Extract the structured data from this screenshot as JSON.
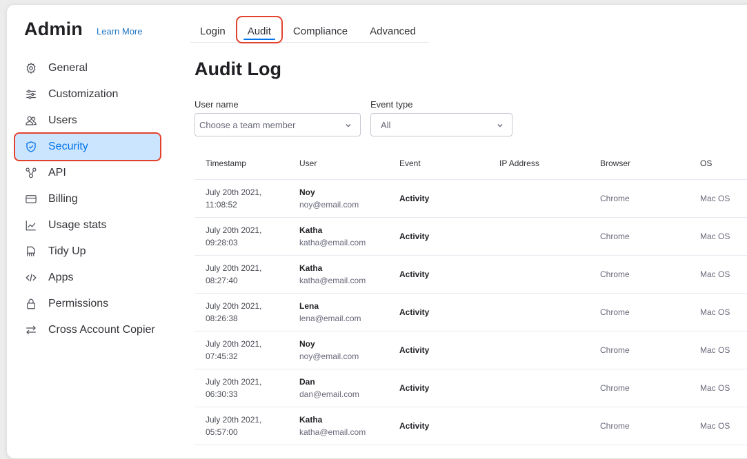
{
  "app": {
    "title": "Admin",
    "learn_more": "Learn More"
  },
  "sidebar": {
    "items": [
      {
        "label": "General",
        "icon": "gear-icon"
      },
      {
        "label": "Customization",
        "icon": "sliders-icon"
      },
      {
        "label": "Users",
        "icon": "users-icon"
      },
      {
        "label": "Security",
        "icon": "shield-icon",
        "active": true
      },
      {
        "label": "API",
        "icon": "api-icon"
      },
      {
        "label": "Billing",
        "icon": "credit-card-icon"
      },
      {
        "label": "Usage stats",
        "icon": "chart-icon"
      },
      {
        "label": "Tidy Up",
        "icon": "broom-icon"
      },
      {
        "label": "Apps",
        "icon": "code-icon"
      },
      {
        "label": "Permissions",
        "icon": "lock-icon"
      },
      {
        "label": "Cross Account Copier",
        "icon": "transfer-icon"
      }
    ]
  },
  "tabs": [
    {
      "label": "Login"
    },
    {
      "label": "Audit",
      "active": true
    },
    {
      "label": "Compliance"
    },
    {
      "label": "Advanced"
    }
  ],
  "page": {
    "title": "Audit Log"
  },
  "filters": {
    "user": {
      "label": "User name",
      "placeholder": "Choose a team member"
    },
    "event": {
      "label": "Event type",
      "value": "All"
    }
  },
  "table": {
    "headers": [
      "Timestamp",
      "User",
      "Event",
      "IP Address",
      "Browser",
      "OS"
    ],
    "rows": [
      {
        "date": "July 20th 2021,",
        "time": "11:08:52",
        "name": "Noy",
        "email": "noy@email.com",
        "event": "Activity",
        "ip": "",
        "browser": "Chrome",
        "os": "Mac OS"
      },
      {
        "date": "July 20th 2021,",
        "time": "09:28:03",
        "name": "Katha",
        "email": "katha@email.com",
        "event": "Activity",
        "ip": "",
        "browser": "Chrome",
        "os": "Mac OS"
      },
      {
        "date": "July 20th 2021,",
        "time": "08:27:40",
        "name": "Katha",
        "email": "katha@email.com",
        "event": "Activity",
        "ip": "",
        "browser": "Chrome",
        "os": "Mac OS"
      },
      {
        "date": "July 20th 2021,",
        "time": "08:26:38",
        "name": "Lena",
        "email": "lena@email.com",
        "event": "Activity",
        "ip": "",
        "browser": "Chrome",
        "os": "Mac OS"
      },
      {
        "date": "July 20th 2021,",
        "time": "07:45:32",
        "name": "Noy",
        "email": "noy@email.com",
        "event": "Activity",
        "ip": "",
        "browser": "Chrome",
        "os": "Mac OS"
      },
      {
        "date": "July 20th 2021,",
        "time": "06:30:33",
        "name": "Dan",
        "email": "dan@email.com",
        "event": "Activity",
        "ip": "",
        "browser": "Chrome",
        "os": "Mac OS"
      },
      {
        "date": "July 20th 2021,",
        "time": "05:57:00",
        "name": "Katha",
        "email": "katha@email.com",
        "event": "Activity",
        "ip": "",
        "browser": "Chrome",
        "os": "Mac OS"
      }
    ]
  },
  "colors": {
    "accent": "#0073ea",
    "active_bg": "#cce5ff",
    "highlight": "#e2422d"
  }
}
